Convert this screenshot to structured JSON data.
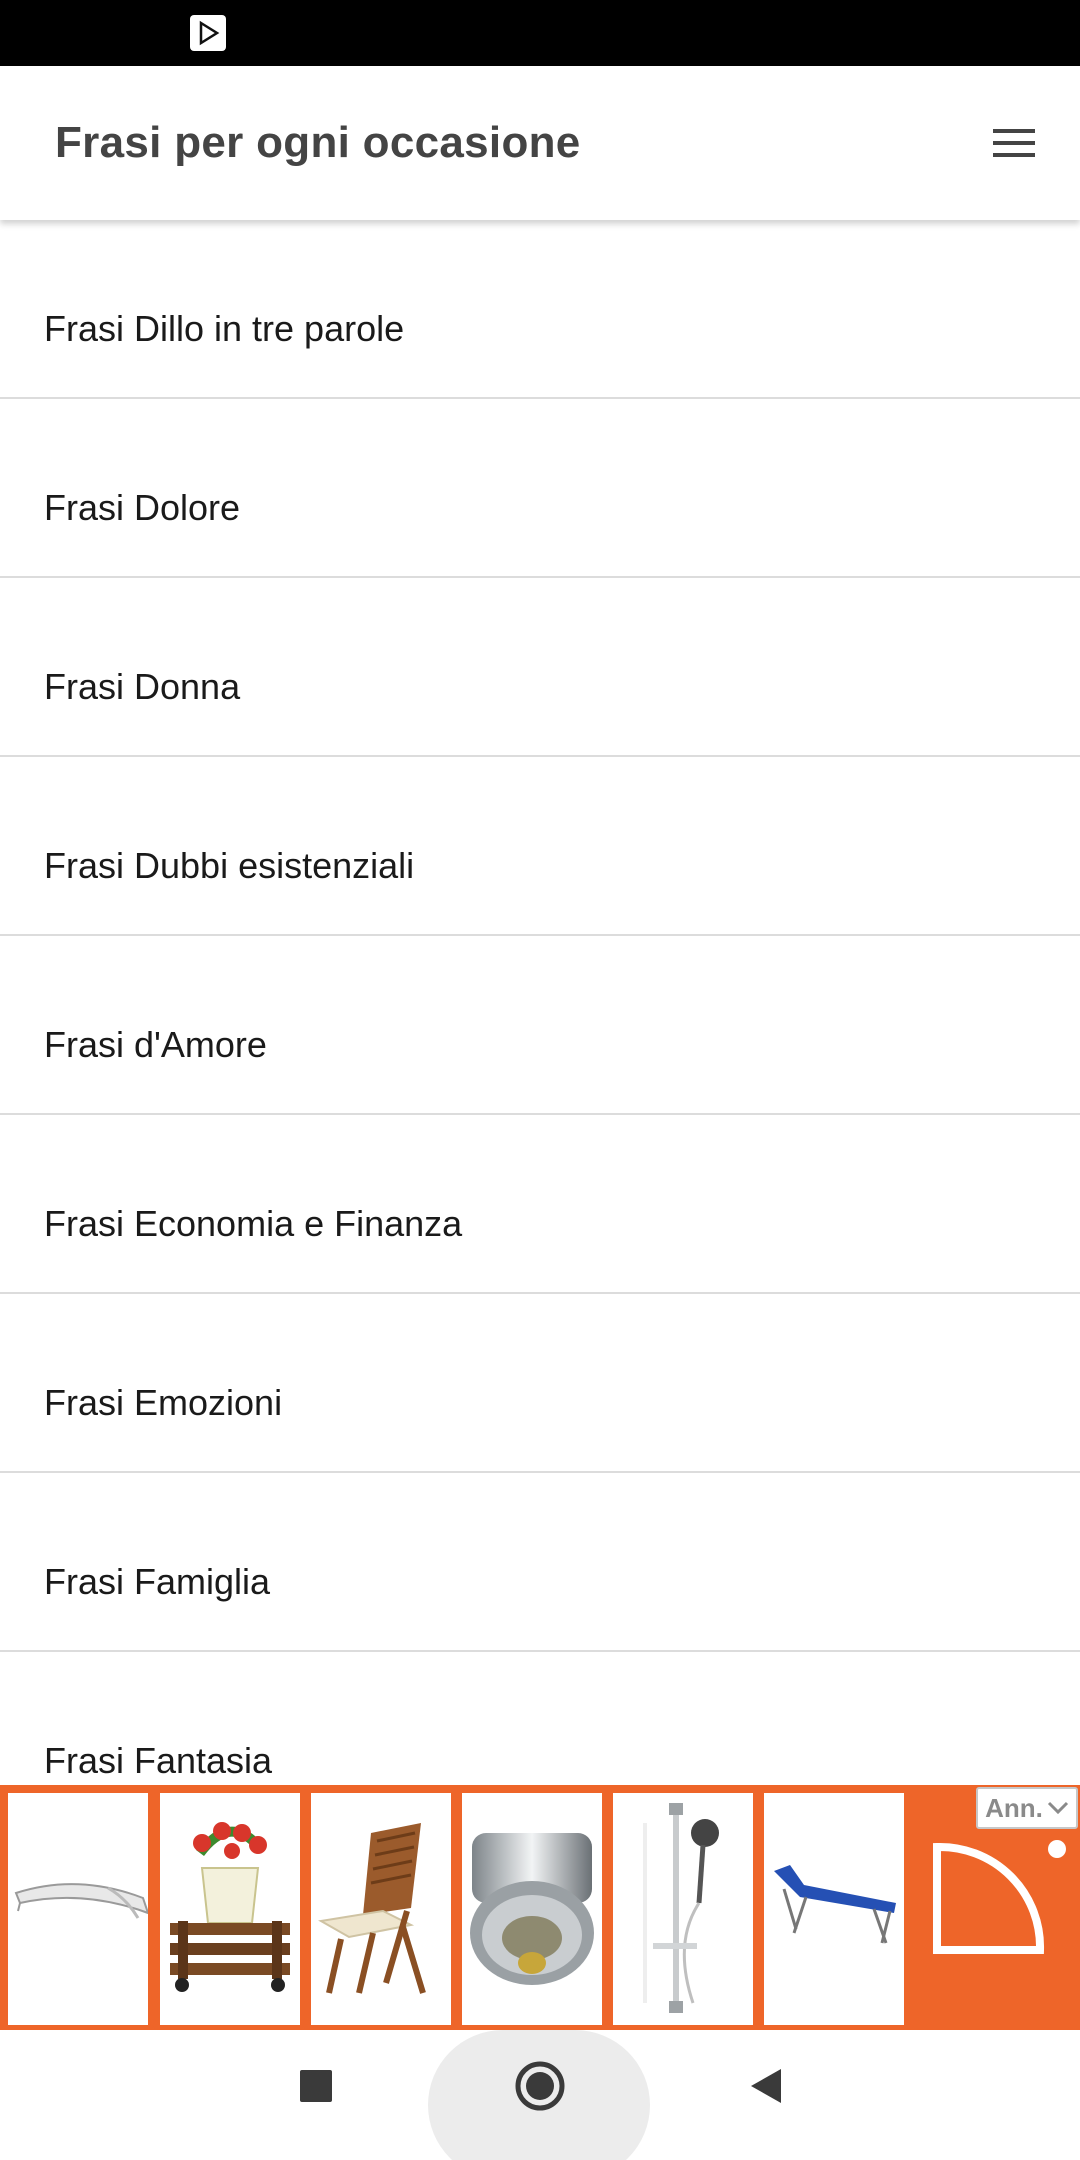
{
  "app_bar": {
    "title": "Frasi per ogni occasione",
    "menu_icon": "hamburger-menu-icon"
  },
  "list": {
    "items": [
      {
        "label": "Frasi Dillo in tre parole"
      },
      {
        "label": "Frasi Dolore"
      },
      {
        "label": "Frasi Donna"
      },
      {
        "label": "Frasi Dubbi esistenziali"
      },
      {
        "label": "Frasi d'Amore"
      },
      {
        "label": "Frasi Economia e Finanza"
      },
      {
        "label": "Frasi Emozioni"
      },
      {
        "label": "Frasi Famiglia"
      },
      {
        "label": "Frasi Fantasia"
      }
    ]
  },
  "ad": {
    "choice_label": "Ann.",
    "brand_color": "#ee6529",
    "products": [
      {
        "icon": "awning-icon"
      },
      {
        "icon": "plant-pot-cart-icon"
      },
      {
        "icon": "wooden-chair-icon"
      },
      {
        "icon": "faucet-aerator-icon"
      },
      {
        "icon": "shower-set-icon"
      },
      {
        "icon": "sun-lounger-icon"
      }
    ]
  },
  "colors": {
    "status_bar": "#000000",
    "title_text": "#444444",
    "item_text": "#1a1a1a",
    "divider": "#dcdcdc",
    "ad_background": "#ee6529"
  }
}
